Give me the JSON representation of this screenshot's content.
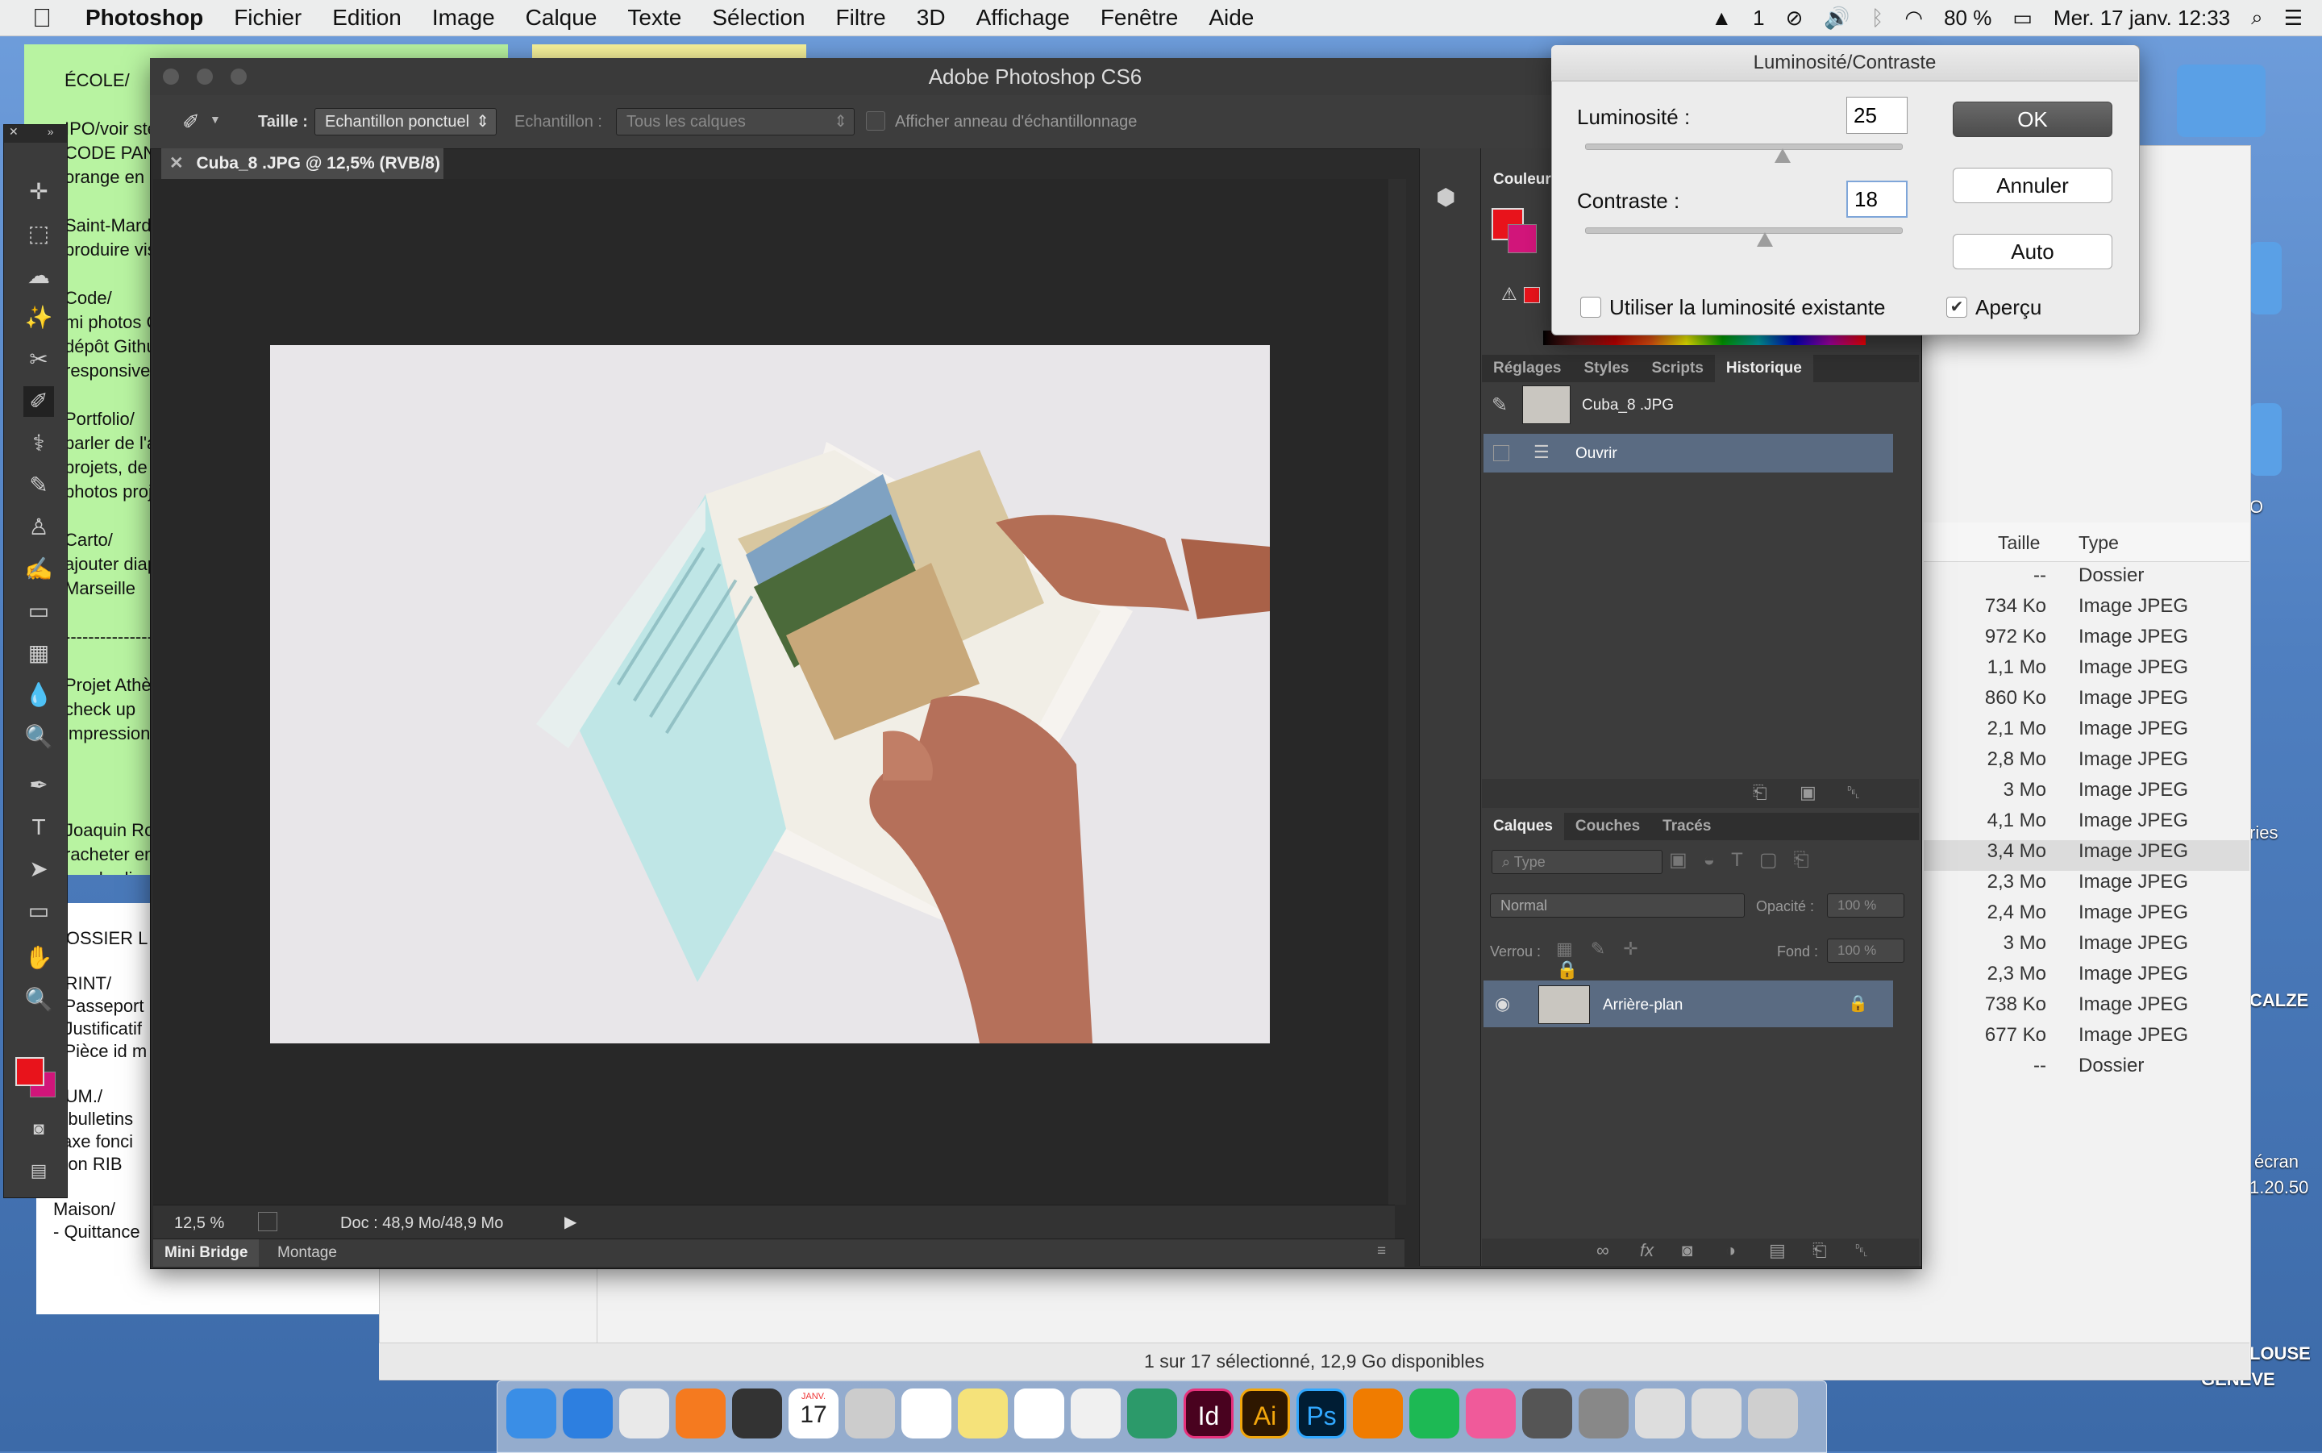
{
  "menubar": {
    "app": "Photoshop",
    "items": [
      "Fichier",
      "Edition",
      "Image",
      "Calque",
      "Texte",
      "Sélection",
      "Filtre",
      "3D",
      "Affichage",
      "Fenêtre",
      "Aide"
    ],
    "status": {
      "input_badge": "1",
      "battery": "80 %",
      "datetime": "Mer. 17 janv. 12:33"
    }
  },
  "sticky": {
    "text": "ÉCOLE/\n\nIPO/voir ste\nCODE PAN\norange en\n\nSaint-Mard\nproduire vis\n\nCode/\nmi photos C\ndépôt Githu\nresponsive\n\nPortfolio/\nparler de l'a\nprojets, de l'i\nphotos proj\n\nCarto/\najouter diap\nMarseille\n\n-----------------\n\nProjet Athèn\ncheck up\nimpression\n\n\n\nJoaquin Rom\nracheter enc\nvendredi : re"
  },
  "sticky_lower": {
    "text": "DOSSIER L\n\nPRINT/\n- Passeport\n- Justificatif\n- Pièce id m\n\nSUM./\n3 bulletins\nTaxe fonci\nmon RIB\n\nMaison/\n- Quittance"
  },
  "desktop_labels": [
    "O",
    "ries",
    "CALZE",
    "écran",
    "1.20.50",
    "LOUSE",
    "GENÈVE"
  ],
  "finder": {
    "col_size": "Taille",
    "col_type": "Type",
    "rows": [
      {
        "size": "--",
        "type": "Dossier"
      },
      {
        "size": "734 Ko",
        "type": "Image JPEG"
      },
      {
        "size": "972 Ko",
        "type": "Image JPEG"
      },
      {
        "size": "1,1 Mo",
        "type": "Image JPEG"
      },
      {
        "size": "860 Ko",
        "type": "Image JPEG"
      },
      {
        "size": "2,1 Mo",
        "type": "Image JPEG"
      },
      {
        "size": "2,8 Mo",
        "type": "Image JPEG"
      },
      {
        "size": "3 Mo",
        "type": "Image JPEG"
      },
      {
        "size": "4,1 Mo",
        "type": "Image JPEG"
      },
      {
        "size": "3,4 Mo",
        "type": "Image JPEG"
      },
      {
        "size": "2,3 Mo",
        "type": "Image JPEG"
      },
      {
        "size": "2,4 Mo",
        "type": "Image JPEG"
      },
      {
        "size": "3 Mo",
        "type": "Image JPEG"
      },
      {
        "size": "2,3 Mo",
        "type": "Image JPEG"
      },
      {
        "size": "738 Ko",
        "type": "Image JPEG"
      },
      {
        "size": "677 Ko",
        "type": "Image JPEG"
      },
      {
        "size": "--",
        "type": "Dossier"
      }
    ],
    "status": "1 sur 17 sélectionné, 12,9 Go disponibles"
  },
  "photoshop": {
    "title": "Adobe Photoshop CS6",
    "options": {
      "taille_label": "Taille :",
      "taille_value": "Echantillon ponctuel",
      "echantillon_label": "Echantillon :",
      "echantillon_value": "Tous les calques",
      "ring_label": "Afficher anneau d'échantillonnage"
    },
    "doc_tab": "Cuba_8 .JPG @ 12,5% (RVB/8)",
    "status": {
      "zoom": "12,5 %",
      "doc": "Doc : 48,9 Mo/48,9 Mo"
    },
    "bottom_tabs": [
      "Mini Bridge",
      "Montage"
    ],
    "color_panel_title": "Couleur",
    "history_tabs": [
      "Réglages",
      "Styles",
      "Scripts",
      "Historique"
    ],
    "history_items": [
      {
        "label": "Cuba_8 .JPG"
      },
      {
        "label": "Ouvrir"
      }
    ],
    "layers_tabs": [
      "Calques",
      "Couches",
      "Tracés"
    ],
    "layers": {
      "filter": "Type",
      "blend": "Normal",
      "opacity_label": "Opacité :",
      "opacity_value": "100 %",
      "lock_label": "Verrou :",
      "fill_label": "Fond :",
      "fill_value": "100 %",
      "items": [
        {
          "label": "Arrière-plan"
        }
      ]
    },
    "fg_color": "#e8131b",
    "bg_color": "#d1157a"
  },
  "dialog": {
    "title": "Luminosité/Contraste",
    "brightness_label": "Luminosité :",
    "brightness_value": "25",
    "brightness_fraction": 0.625,
    "contrast_label": "Contraste :",
    "contrast_value": "18",
    "contrast_fraction": 0.57,
    "ok": "OK",
    "cancel": "Annuler",
    "auto": "Auto",
    "legacy_label": "Utiliser la luminosité existante",
    "preview_label": "Aperçu",
    "preview_checked": true,
    "legacy_checked": false
  },
  "dock": {
    "calendar_month": "JANV.",
    "calendar_day": "17",
    "apps": [
      "finder-icon",
      "safari-icon",
      "chrome-icon",
      "firefox-icon",
      "photo-booth-icon",
      "calendar-icon",
      "preview-icon",
      "photos-icon",
      "stickies-icon",
      "notes-icon",
      "textedit-icon",
      "atom-icon",
      "indesign-icon",
      "illustrator-icon",
      "photoshop-icon",
      "vlc-icon",
      "spotify-icon",
      "itunes-icon",
      "fontbook-icon",
      "system-preferences-icon",
      "screenshot-icon",
      "screenshot-icon-2",
      "trash-icon"
    ],
    "indesign": "Id",
    "illustrator": "Ai",
    "photoshop": "Ps"
  }
}
